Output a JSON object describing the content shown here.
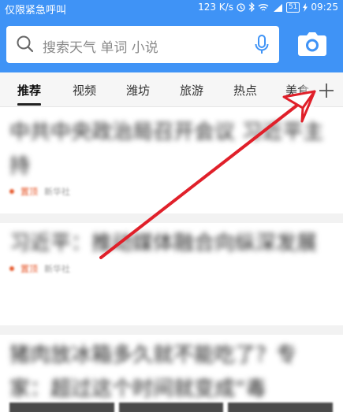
{
  "status_bar": {
    "carrier": "仅限紧急呼叫",
    "speed": "123 K/s",
    "battery": "51",
    "time": "09:25"
  },
  "search": {
    "placeholder": "搜索天气 单词 小说",
    "icons": [
      "search-icon",
      "microphone-icon",
      "camera-icon"
    ]
  },
  "tabs": {
    "items": [
      "推荐",
      "视频",
      "潍坊",
      "旅游",
      "热点",
      "美食"
    ],
    "active": "推荐",
    "add_icon": "plus-icon"
  },
  "feed": {
    "items": [
      {
        "title": "中共中央政治局召开会议 习近平主持",
        "tag": "置顶",
        "source": "新华社"
      },
      {
        "title": "习近平：推动媒体融合向纵深发展",
        "tag": "置顶",
        "source": "新华社"
      },
      {
        "title": "猪肉放冰箱多久就不能吃了？专家：超过这个时间就变成“毒",
        "tag": "",
        "source": ""
      }
    ]
  },
  "colors": {
    "header_blue": "#3f93f6",
    "arrow_red": "#e0202a",
    "tag_orange": "#e65a2e"
  }
}
